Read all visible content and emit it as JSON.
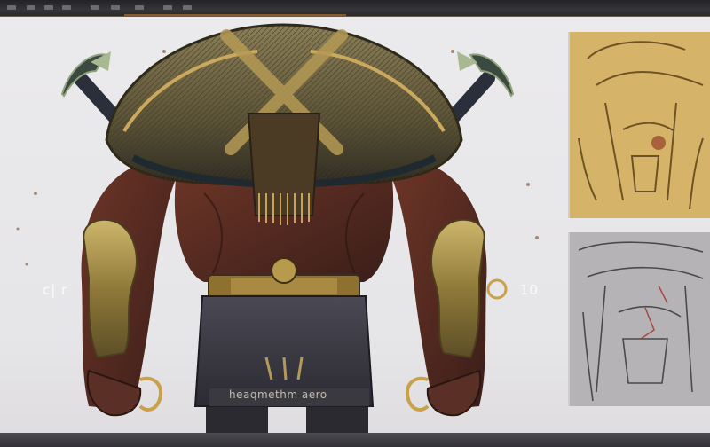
{
  "artwork": {
    "subject": "armored warrior back view with crossed swords",
    "palette": {
      "background": "#e9e8ea",
      "armor_gold": "#a88a3c",
      "armor_dark": "#3b342c",
      "skin": "#5a2e24",
      "cloth": "#3c3b44",
      "sword": "#2b2f3b"
    }
  },
  "labels": {
    "left_mark": "c| r",
    "right_mark": "10",
    "caption": "heaqmethm aero"
  },
  "thumbnails": [
    {
      "name": "color-sketch",
      "tone": "#d5b46a"
    },
    {
      "name": "gray-sketch",
      "tone": "#b5b3b6"
    }
  ]
}
